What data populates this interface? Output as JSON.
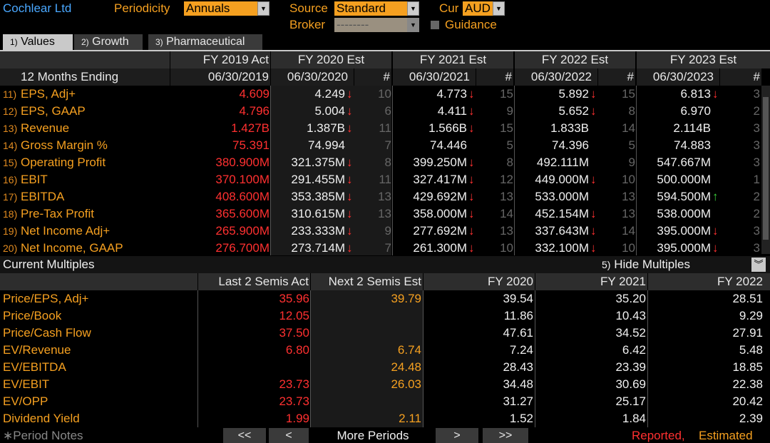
{
  "header": {
    "company": "Cochlear Ltd",
    "periodicity_label": "Periodicity",
    "periodicity_value": "Annuals",
    "source_label": "Source",
    "source_value": "Standard",
    "cur_label": "Cur",
    "cur_value": "AUD",
    "broker_label": "Broker",
    "broker_value": "--------",
    "guidance_label": "Guidance"
  },
  "tabs": [
    {
      "num": "1)",
      "label": "Values"
    },
    {
      "num": "2)",
      "label": "Growth"
    },
    {
      "num": "3)",
      "label": "Pharmaceutical"
    }
  ],
  "grid": {
    "col_headers": [
      "FY 2019 Act",
      "FY 2020 Est",
      "FY 2021 Est",
      "FY 2022 Est",
      "FY 2023 Est"
    ],
    "row_header_label": "12 Months Ending",
    "dates": [
      "06/30/2019",
      "06/30/2020",
      "06/30/2021",
      "06/30/2022",
      "06/30/2023"
    ],
    "count_symbol": "#",
    "rows": [
      {
        "num": "11)",
        "label": "EPS, Adj+",
        "v2019": "4.609",
        "v2020": "4.249",
        "a2020": "↓",
        "n2020": "10",
        "v2021": "4.773",
        "a2021": "↓",
        "n2021": "15",
        "v2022": "5.892",
        "a2022": "↓",
        "n2022": "15",
        "v2023": "6.813",
        "a2023": "↓",
        "n2023": "3"
      },
      {
        "num": "12)",
        "label": "EPS, GAAP",
        "v2019": "4.796",
        "v2020": "5.004",
        "a2020": "↓",
        "n2020": "6",
        "v2021": "4.411",
        "a2021": "↓",
        "n2021": "9",
        "v2022": "5.652",
        "a2022": "↓",
        "n2022": "8",
        "v2023": "6.970",
        "a2023": "",
        "n2023": "2"
      },
      {
        "num": "13)",
        "label": "Revenue",
        "v2019": "1.427B",
        "v2020": "1.387B",
        "a2020": "↓",
        "n2020": "11",
        "v2021": "1.566B",
        "a2021": "↓",
        "n2021": "15",
        "v2022": "1.833B",
        "a2022": "",
        "n2022": "14",
        "v2023": "2.114B",
        "a2023": "",
        "n2023": "3"
      },
      {
        "num": "14)",
        "label": "Gross Margin %",
        "v2019": "75.391",
        "v2020": "74.994",
        "a2020": "",
        "n2020": "7",
        "v2021": "74.446",
        "a2021": "",
        "n2021": "5",
        "v2022": "74.396",
        "a2022": "",
        "n2022": "5",
        "v2023": "74.883",
        "a2023": "",
        "n2023": "3"
      },
      {
        "num": "15)",
        "label": "Operating Profit",
        "v2019": "380.900M",
        "v2020": "321.375M",
        "a2020": "↓",
        "n2020": "8",
        "v2021": "399.250M",
        "a2021": "↓",
        "n2021": "8",
        "v2022": "492.111M",
        "a2022": "",
        "n2022": "9",
        "v2023": "547.667M",
        "a2023": "",
        "n2023": "3"
      },
      {
        "num": "16)",
        "label": "EBIT",
        "v2019": "370.100M",
        "v2020": "291.455M",
        "a2020": "↓",
        "n2020": "11",
        "v2021": "327.417M",
        "a2021": "↓",
        "n2021": "12",
        "v2022": "449.000M",
        "a2022": "↓",
        "n2022": "10",
        "v2023": "500.000M",
        "a2023": "",
        "n2023": "1"
      },
      {
        "num": "17)",
        "label": "EBITDA",
        "v2019": "408.600M",
        "v2020": "353.385M",
        "a2020": "↓",
        "n2020": "13",
        "v2021": "429.692M",
        "a2021": "↓",
        "n2021": "13",
        "v2022": "533.000M",
        "a2022": "",
        "n2022": "13",
        "v2023": "594.500M",
        "a2023": "↑",
        "n2023": "2"
      },
      {
        "num": "18)",
        "label": "Pre-Tax Profit",
        "v2019": "365.600M",
        "v2020": "310.615M",
        "a2020": "↓",
        "n2020": "13",
        "v2021": "358.000M",
        "a2021": "↓",
        "n2021": "14",
        "v2022": "452.154M",
        "a2022": "↓",
        "n2022": "13",
        "v2023": "538.000M",
        "a2023": "",
        "n2023": "2"
      },
      {
        "num": "19)",
        "label": "Net Income Adj+",
        "v2019": "265.900M",
        "v2020": "233.333M",
        "a2020": "↓",
        "n2020": "9",
        "v2021": "277.692M",
        "a2021": "↓",
        "n2021": "13",
        "v2022": "337.643M",
        "a2022": "↓",
        "n2022": "14",
        "v2023": "395.000M",
        "a2023": "↓",
        "n2023": "3"
      },
      {
        "num": "20)",
        "label": "Net Income, GAAP",
        "v2019": "276.700M",
        "v2020": "273.714M",
        "a2020": "↓",
        "n2020": "7",
        "v2021": "261.300M",
        "a2021": "↓",
        "n2021": "10",
        "v2022": "332.100M",
        "a2022": "↓",
        "n2022": "10",
        "v2023": "395.000M",
        "a2023": "↓",
        "n2023": "3"
      }
    ]
  },
  "multiples": {
    "title": "Current Multiples",
    "hide_num": "5)",
    "hide_label": "Hide Multiples",
    "col_headers": [
      "Last 2 Semis Act",
      "Next 2 Semis Est",
      "FY 2020",
      "FY 2021",
      "FY 2022"
    ],
    "rows": [
      {
        "label": "Price/EPS, Adj+",
        "last": "35.96",
        "next": "39.79",
        "fy2020": "39.54",
        "fy2021": "35.20",
        "fy2022": "28.51"
      },
      {
        "label": "Price/Book",
        "last": "12.05",
        "next": "",
        "fy2020": "11.86",
        "fy2021": "10.43",
        "fy2022": "9.29"
      },
      {
        "label": "Price/Cash Flow",
        "last": "37.50",
        "next": "",
        "fy2020": "47.61",
        "fy2021": "34.52",
        "fy2022": "27.91"
      },
      {
        "label": "EV/Revenue",
        "last": "6.80",
        "next": "6.74",
        "fy2020": "7.24",
        "fy2021": "6.42",
        "fy2022": "5.48"
      },
      {
        "label": "EV/EBITDA",
        "last": "",
        "next": "24.48",
        "fy2020": "28.43",
        "fy2021": "23.39",
        "fy2022": "18.85"
      },
      {
        "label": "EV/EBIT",
        "last": "23.73",
        "next": "26.03",
        "fy2020": "34.48",
        "fy2021": "30.69",
        "fy2022": "22.38"
      },
      {
        "label": "EV/OPP",
        "last": "23.73",
        "next": "",
        "fy2020": "31.27",
        "fy2021": "25.17",
        "fy2022": "20.42"
      },
      {
        "label": "Dividend Yield",
        "last": "1.99",
        "next": "2.11",
        "fy2020": "1.52",
        "fy2021": "1.84",
        "fy2022": "2.39"
      }
    ]
  },
  "footer": {
    "period_notes": "∗Period Notes",
    "first_btn": "<<",
    "prev_btn": "<",
    "more_periods": "More Periods",
    "next_btn": ">",
    "last_btn": ">>",
    "reported": "Reported,",
    "estimated": "Estimated"
  },
  "colors": {
    "accent": "#f5a020",
    "company": "#4aa8ff",
    "down": "#ff3030",
    "up": "#3cd23c"
  },
  "icons": [
    "dropdown-arrow-icon",
    "down-arrow-icon",
    "up-arrow-icon",
    "collapse-icon"
  ]
}
